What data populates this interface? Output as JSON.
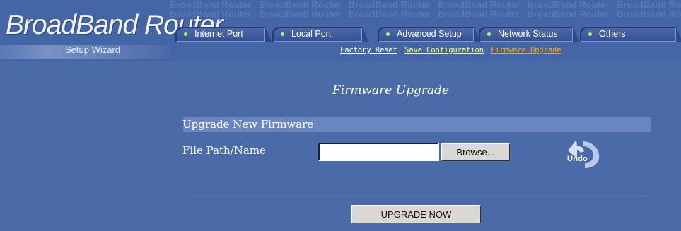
{
  "header": {
    "brand_title": "BroadBand Router",
    "watermark_text": "BroadBand Router",
    "setup_wizard": "Setup Wizard"
  },
  "tabs": [
    {
      "label": "Internet Port"
    },
    {
      "label": "Local Port"
    },
    {
      "label": "Advanced Setup"
    },
    {
      "label": "Network Status"
    },
    {
      "label": "Others"
    }
  ],
  "sublinks": [
    {
      "label": "Factory Reset",
      "color": "#ffffff"
    },
    {
      "label": "Save Configuration",
      "color": "#ffff66"
    },
    {
      "label": "Firmware Upgrade",
      "color": "#ffa500"
    }
  ],
  "main": {
    "page_title": "Firmware Upgrade",
    "section_title": "Upgrade New Firmware",
    "file_label": "File Path/Name",
    "file_value": "",
    "browse_label": "Browse...",
    "undo_label": "Undo",
    "submit_label": "UPGRADE NOW"
  },
  "colors": {
    "background": "#4a6aa8",
    "tab_dot": "#9df96b",
    "section_bar": "#6a85bf"
  },
  "icons": {
    "tab_indicator": "green-dot-icon",
    "undo": "curved-arrow-undo-icon"
  }
}
